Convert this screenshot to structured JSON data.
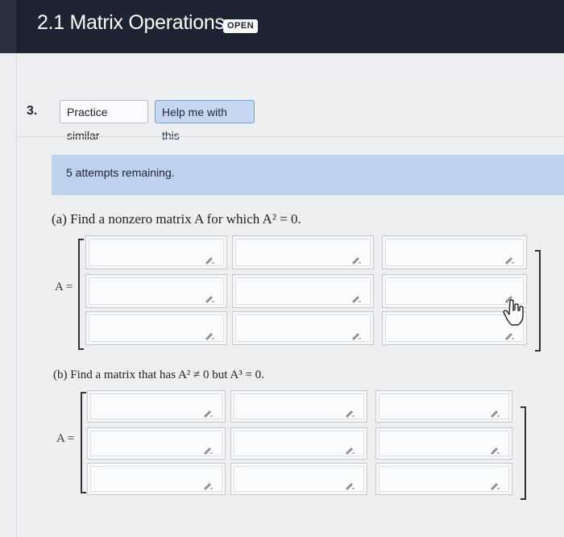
{
  "header": {
    "title": "2.1 Matrix Operations",
    "badge": "OPEN"
  },
  "question": {
    "number": "3.",
    "practice_label": "Practice similar",
    "help_label": "Help me with this"
  },
  "attempts_text": "5 attempts remaining.",
  "part_a": {
    "prompt": "(a) Find a nonzero matrix A for which A² = 0.",
    "lhs": "A ="
  },
  "part_b": {
    "prompt": "(b) Find a matrix that has A² ≠ 0 but A³ = 0.",
    "lhs": "A ="
  },
  "colors": {
    "header_bg": "#1c2331",
    "attempts_bg": "#bcd3ee",
    "help_bg": "#c6d8ef"
  },
  "icons": {
    "cell_icon": "pencil-icon",
    "pointer": "hand-cursor-icon"
  }
}
